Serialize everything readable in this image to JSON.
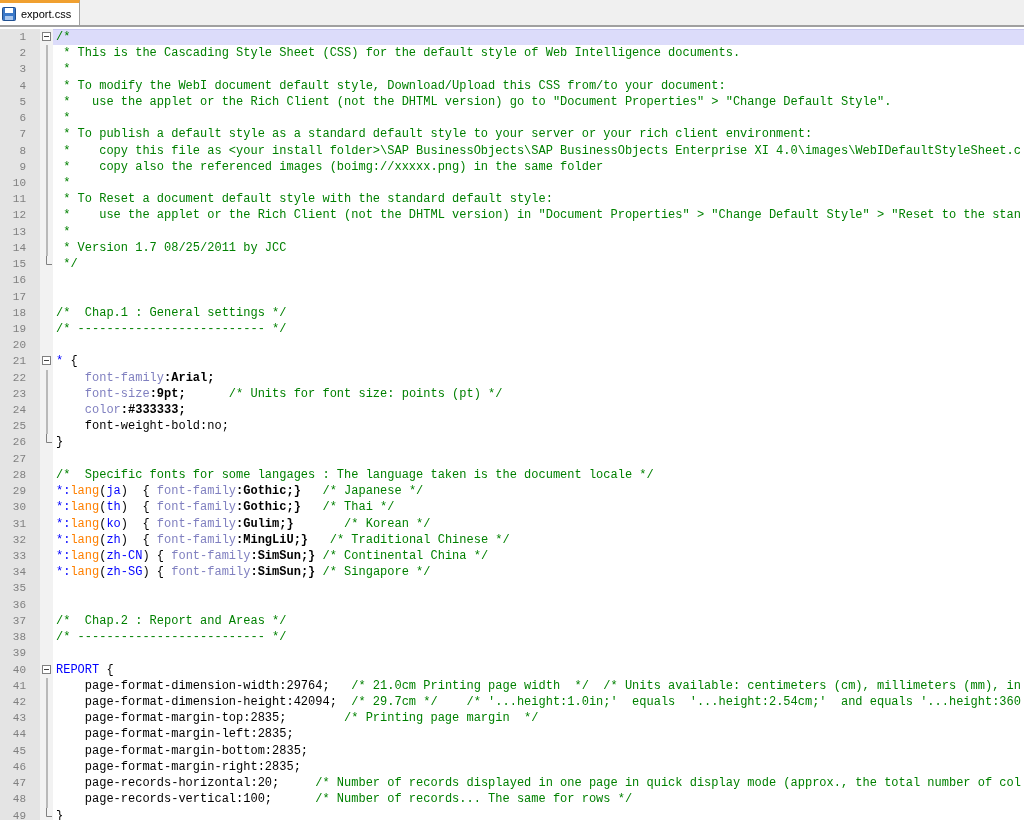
{
  "tabs": [
    {
      "label": "export.css",
      "selected": true
    }
  ],
  "lines": [
    {
      "number": "1",
      "current": true,
      "kind": "open",
      "tokens": [
        {
          "kind": "comment",
          "text": "/*"
        }
      ]
    },
    {
      "number": "2",
      "current": false,
      "kind": "inner",
      "tokens": [
        {
          "kind": "comment",
          "text": " * This is the Cascading Style Sheet (CSS) for the default style of Web Intelligence documents."
        }
      ]
    },
    {
      "number": "3",
      "current": false,
      "kind": "inner",
      "tokens": [
        {
          "kind": "comment",
          "text": " *"
        }
      ]
    },
    {
      "number": "4",
      "current": false,
      "kind": "inner",
      "tokens": [
        {
          "kind": "comment",
          "text": " * To modify the WebI document default style, Download/Upload this CSS from/to your document:"
        }
      ]
    },
    {
      "number": "5",
      "current": false,
      "kind": "inner",
      "tokens": [
        {
          "kind": "comment",
          "text": " *   use the applet or the Rich Client (not the DHTML version) go to \"Document Properties\" > \"Change Default Style\"."
        }
      ]
    },
    {
      "number": "6",
      "current": false,
      "kind": "inner",
      "tokens": [
        {
          "kind": "comment",
          "text": " *"
        }
      ]
    },
    {
      "number": "7",
      "current": false,
      "kind": "inner",
      "tokens": [
        {
          "kind": "comment",
          "text": " * To publish a default style as a standard default style to your server or your rich client environment:"
        }
      ]
    },
    {
      "number": "8",
      "current": false,
      "kind": "inner",
      "tokens": [
        {
          "kind": "comment",
          "text": " *    copy this file as <your install folder>\\SAP BusinessObjects\\SAP BusinessObjects Enterprise XI 4.0\\images\\WebIDefaultStyleSheet.c"
        }
      ]
    },
    {
      "number": "9",
      "current": false,
      "kind": "inner",
      "tokens": [
        {
          "kind": "comment",
          "text": " *    copy also the referenced images (boimg://xxxxx.png) in the same folder"
        }
      ]
    },
    {
      "number": "10",
      "current": false,
      "kind": "inner",
      "tokens": [
        {
          "kind": "comment",
          "text": " *"
        }
      ]
    },
    {
      "number": "11",
      "current": false,
      "kind": "inner",
      "tokens": [
        {
          "kind": "comment",
          "text": " * To Reset a document default style with the standard default style:"
        }
      ]
    },
    {
      "number": "12",
      "current": false,
      "kind": "inner",
      "tokens": [
        {
          "kind": "comment",
          "text": " *    use the applet or the Rich Client (not the DHTML version) in \"Document Properties\" > \"Change Default Style\" > \"Reset to the stan"
        }
      ]
    },
    {
      "number": "13",
      "current": false,
      "kind": "inner",
      "tokens": [
        {
          "kind": "comment",
          "text": " *"
        }
      ]
    },
    {
      "number": "14",
      "current": false,
      "kind": "inner",
      "tokens": [
        {
          "kind": "comment",
          "text": " * Version 1.7 08/25/2011 by JCC"
        }
      ]
    },
    {
      "number": "15",
      "current": false,
      "kind": "close",
      "tokens": [
        {
          "kind": "comment",
          "text": " */"
        }
      ]
    },
    {
      "number": "16",
      "current": false,
      "kind": "plain"
    },
    {
      "number": "17",
      "current": false,
      "kind": "plain"
    },
    {
      "number": "18",
      "current": false,
      "kind": "plain",
      "tokens": [
        {
          "kind": "comment",
          "text": "/*  Chap.1 : General settings */"
        }
      ]
    },
    {
      "number": "19",
      "current": false,
      "kind": "plain",
      "tokens": [
        {
          "kind": "comment",
          "text": "/* -------------------------- */"
        }
      ]
    },
    {
      "number": "20",
      "current": false,
      "kind": "plain"
    },
    {
      "number": "21",
      "current": false,
      "kind": "open",
      "tokens": [
        {
          "kind": "selector",
          "text": "*"
        },
        {
          "kind": "plain",
          "text": " {"
        }
      ]
    },
    {
      "number": "22",
      "current": false,
      "kind": "inner",
      "tokens": [
        {
          "kind": "property",
          "text": "    font-family"
        },
        {
          "kind": "value",
          "text": ":Arial;"
        }
      ]
    },
    {
      "number": "23",
      "current": false,
      "kind": "inner",
      "tokens": [
        {
          "kind": "property",
          "text": "    font-size"
        },
        {
          "kind": "value",
          "text": ":9pt;"
        },
        {
          "kind": "comment",
          "text": "      /* Units for font size: points (pt) */"
        }
      ]
    },
    {
      "number": "24",
      "current": false,
      "kind": "inner",
      "tokens": [
        {
          "kind": "property",
          "text": "    color"
        },
        {
          "kind": "value",
          "text": ":#333333;"
        }
      ]
    },
    {
      "number": "25",
      "current": false,
      "kind": "inner",
      "tokens": [
        {
          "kind": "plain",
          "text": "    font-weight-bold:no;"
        }
      ]
    },
    {
      "number": "26",
      "current": false,
      "kind": "close",
      "tokens": [
        {
          "kind": "plain",
          "text": "}"
        }
      ]
    },
    {
      "number": "27",
      "current": false,
      "kind": "plain"
    },
    {
      "number": "28",
      "current": false,
      "kind": "plain",
      "tokens": [
        {
          "kind": "comment",
          "text": "/*  Specific fonts for some langages : The language taken is the document locale */"
        }
      ]
    },
    {
      "number": "29",
      "current": false,
      "kind": "plain",
      "tokens": [
        {
          "kind": "selector",
          "text": "*:"
        },
        {
          "kind": "pseudo",
          "text": "lang"
        },
        {
          "kind": "plain",
          "text": "("
        },
        {
          "kind": "argument",
          "text": "ja"
        },
        {
          "kind": "plain",
          "text": ")  { "
        },
        {
          "kind": "property",
          "text": "font-family"
        },
        {
          "kind": "value",
          "text": ":Gothic;}"
        },
        {
          "kind": "comment",
          "text": "   /* Japanese */"
        }
      ]
    },
    {
      "number": "30",
      "current": false,
      "kind": "plain",
      "tokens": [
        {
          "kind": "selector",
          "text": "*:"
        },
        {
          "kind": "pseudo",
          "text": "lang"
        },
        {
          "kind": "plain",
          "text": "("
        },
        {
          "kind": "argument",
          "text": "th"
        },
        {
          "kind": "plain",
          "text": ")  { "
        },
        {
          "kind": "property",
          "text": "font-family"
        },
        {
          "kind": "value",
          "text": ":Gothic;}"
        },
        {
          "kind": "comment",
          "text": "   /* Thai */"
        }
      ]
    },
    {
      "number": "31",
      "current": false,
      "kind": "plain",
      "tokens": [
        {
          "kind": "selector",
          "text": "*:"
        },
        {
          "kind": "pseudo",
          "text": "lang"
        },
        {
          "kind": "plain",
          "text": "("
        },
        {
          "kind": "argument",
          "text": "ko"
        },
        {
          "kind": "plain",
          "text": ")  { "
        },
        {
          "kind": "property",
          "text": "font-family"
        },
        {
          "kind": "value",
          "text": ":Gulim;}"
        },
        {
          "kind": "comment",
          "text": "       /* Korean */"
        }
      ]
    },
    {
      "number": "32",
      "current": false,
      "kind": "plain",
      "tokens": [
        {
          "kind": "selector",
          "text": "*:"
        },
        {
          "kind": "pseudo",
          "text": "lang"
        },
        {
          "kind": "plain",
          "text": "("
        },
        {
          "kind": "argument",
          "text": "zh"
        },
        {
          "kind": "plain",
          "text": ")  { "
        },
        {
          "kind": "property",
          "text": "font-family"
        },
        {
          "kind": "value",
          "text": ":MingLiU;}"
        },
        {
          "kind": "comment",
          "text": "   /* Traditional Chinese */"
        }
      ]
    },
    {
      "number": "33",
      "current": false,
      "kind": "plain",
      "tokens": [
        {
          "kind": "selector",
          "text": "*:"
        },
        {
          "kind": "pseudo",
          "text": "lang"
        },
        {
          "kind": "plain",
          "text": "("
        },
        {
          "kind": "argument",
          "text": "zh-CN"
        },
        {
          "kind": "plain",
          "text": ") { "
        },
        {
          "kind": "property",
          "text": "font-family"
        },
        {
          "kind": "value",
          "text": ":SimSun;}"
        },
        {
          "kind": "comment",
          "text": " /* Continental China */"
        }
      ]
    },
    {
      "number": "34",
      "current": false,
      "kind": "plain",
      "tokens": [
        {
          "kind": "selector",
          "text": "*:"
        },
        {
          "kind": "pseudo",
          "text": "lang"
        },
        {
          "kind": "plain",
          "text": "("
        },
        {
          "kind": "argument",
          "text": "zh-SG"
        },
        {
          "kind": "plain",
          "text": ") { "
        },
        {
          "kind": "property",
          "text": "font-family"
        },
        {
          "kind": "value",
          "text": ":SimSun;}"
        },
        {
          "kind": "comment",
          "text": " /* Singapore */"
        }
      ]
    },
    {
      "number": "35",
      "current": false,
      "kind": "plain"
    },
    {
      "number": "36",
      "current": false,
      "kind": "plain"
    },
    {
      "number": "37",
      "current": false,
      "kind": "plain",
      "tokens": [
        {
          "kind": "comment",
          "text": "/*  Chap.2 : Report and Areas */"
        }
      ]
    },
    {
      "number": "38",
      "current": false,
      "kind": "plain",
      "tokens": [
        {
          "kind": "comment",
          "text": "/* -------------------------- */"
        }
      ]
    },
    {
      "number": "39",
      "current": false,
      "kind": "plain"
    },
    {
      "number": "40",
      "current": false,
      "kind": "open",
      "tokens": [
        {
          "kind": "selector",
          "text": "REPORT"
        },
        {
          "kind": "plain",
          "text": " {"
        }
      ]
    },
    {
      "number": "41",
      "current": false,
      "kind": "inner",
      "tokens": [
        {
          "kind": "plain",
          "text": "    page-format-dimension-width:29764;"
        },
        {
          "kind": "comment",
          "text": "   /* 21.0cm Printing page width  */  /* Units available: centimeters (cm), millimeters (mm), in"
        }
      ]
    },
    {
      "number": "42",
      "current": false,
      "kind": "inner",
      "tokens": [
        {
          "kind": "plain",
          "text": "    page-format-dimension-height:42094;"
        },
        {
          "kind": "comment",
          "text": "  /* 29.7cm */    /* '...height:1.0in;'  equals  '...height:2.54cm;'  and equals '...height:360"
        }
      ]
    },
    {
      "number": "43",
      "current": false,
      "kind": "inner",
      "tokens": [
        {
          "kind": "plain",
          "text": "    page-format-margin-top:2835;"
        },
        {
          "kind": "comment",
          "text": "        /* Printing page margin  */"
        }
      ]
    },
    {
      "number": "44",
      "current": false,
      "kind": "inner",
      "tokens": [
        {
          "kind": "plain",
          "text": "    page-format-margin-left:2835;"
        }
      ]
    },
    {
      "number": "45",
      "current": false,
      "kind": "inner",
      "tokens": [
        {
          "kind": "plain",
          "text": "    page-format-margin-bottom:2835;"
        }
      ]
    },
    {
      "number": "46",
      "current": false,
      "kind": "inner",
      "tokens": [
        {
          "kind": "plain",
          "text": "    page-format-margin-right:2835;"
        }
      ]
    },
    {
      "number": "47",
      "current": false,
      "kind": "inner",
      "tokens": [
        {
          "kind": "plain",
          "text": "    page-records-horizontal:20;"
        },
        {
          "kind": "comment",
          "text": "     /* Number of records displayed in one page in quick display mode (approx., the total number of col"
        }
      ]
    },
    {
      "number": "48",
      "current": false,
      "kind": "inner",
      "tokens": [
        {
          "kind": "plain",
          "text": "    page-records-vertical:100;"
        },
        {
          "kind": "comment",
          "text": "      /* Number of records... The same for rows */"
        }
      ]
    },
    {
      "number": "49",
      "current": false,
      "kind": "close",
      "tokens": [
        {
          "kind": "plain",
          "text": "}"
        }
      ]
    }
  ]
}
